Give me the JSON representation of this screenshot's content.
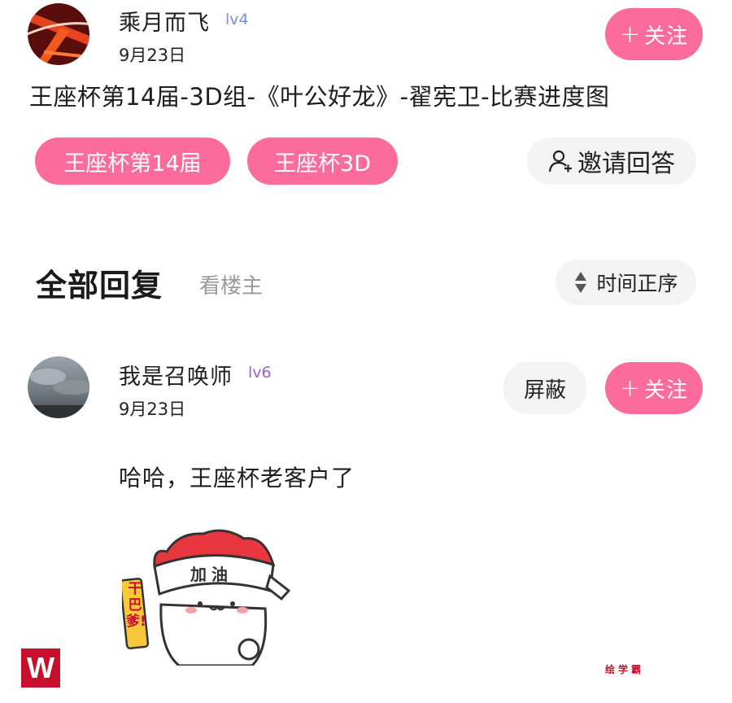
{
  "post": {
    "author": {
      "name": "乘月而飞",
      "level": "lv4",
      "date": "9月23日",
      "avatar": "avatar-abstract-red"
    },
    "follow_label": "关注",
    "follow_plus": "+",
    "title": "王座杯第14届-3D组-《叶公好龙》-翟宪卫-比赛进度图",
    "tags": [
      "王座杯第14届",
      "王座杯3D"
    ],
    "invite_label": "邀请回答",
    "invite_icon": "user-plus-icon"
  },
  "replies_header": {
    "title": "全部回复",
    "filter_label": "看楼主",
    "sort_label": "时间正序",
    "sort_icon": "sort-updown-icon"
  },
  "reply": {
    "author": {
      "name": "我是召唤师",
      "level": "lv6",
      "date": "9月23日",
      "avatar": "avatar-cloudy-sky"
    },
    "block_label": "屏蔽",
    "follow_label": "关注",
    "follow_plus": "+",
    "text": "哈哈，王座杯老客户了",
    "sticker": {
      "hat_text": "加油",
      "side_text": "干巴爹!"
    }
  },
  "watermark": {
    "logo_letter": "W",
    "brand_text": "绘学霸"
  },
  "colors": {
    "accent": "#fb6b9b",
    "lv4": "#7b8fd6",
    "lv6": "#9a5fd0",
    "pill_bg": "#f3f3f3",
    "logo": "#c8102e"
  }
}
